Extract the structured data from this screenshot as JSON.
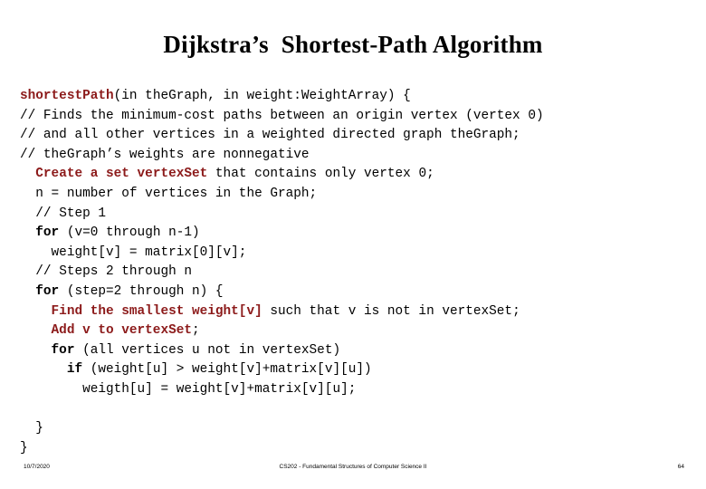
{
  "slide": {
    "title": "Dijkstra’s  Shortest-Path Algorithm",
    "colors": {
      "background": "#ffffff",
      "text": "#000000",
      "highlight_red": "#8C1A1A"
    }
  },
  "code": {
    "lines": [
      {
        "indent": 0,
        "segments": [
          {
            "style": "hl",
            "text": "shortestPath"
          },
          {
            "style": "plain",
            "text": "(in theGraph, in weight:WeightArray) {"
          }
        ]
      },
      {
        "indent": 0,
        "segments": [
          {
            "style": "plain",
            "text": "// Finds the minimum-cost paths between an origin vertex (vertex 0)"
          }
        ]
      },
      {
        "indent": 0,
        "segments": [
          {
            "style": "plain",
            "text": "// and all other vertices in a weighted directed graph theGraph;"
          }
        ]
      },
      {
        "indent": 0,
        "segments": [
          {
            "style": "plain",
            "text": "// theGraph’s weights are nonnegative"
          }
        ]
      },
      {
        "indent": 1,
        "segments": [
          {
            "style": "hl",
            "text": "Create a set vertexSet"
          },
          {
            "style": "plain",
            "text": " that contains only vertex 0;"
          }
        ]
      },
      {
        "indent": 1,
        "segments": [
          {
            "style": "plain",
            "text": "n = number of vertices in the Graph;"
          }
        ]
      },
      {
        "indent": 1,
        "segments": [
          {
            "style": "plain",
            "text": "// Step 1"
          }
        ]
      },
      {
        "indent": 1,
        "segments": [
          {
            "style": "kw",
            "text": "for"
          },
          {
            "style": "plain",
            "text": " (v=0 through n-1)"
          }
        ]
      },
      {
        "indent": 2,
        "segments": [
          {
            "style": "plain",
            "text": "weight[v] = matrix[0][v];"
          }
        ]
      },
      {
        "indent": 1,
        "segments": [
          {
            "style": "plain",
            "text": "// Steps 2 through n"
          }
        ]
      },
      {
        "indent": 1,
        "segments": [
          {
            "style": "kw",
            "text": "for"
          },
          {
            "style": "plain",
            "text": " (step=2 through n) {"
          }
        ]
      },
      {
        "indent": 2,
        "segments": [
          {
            "style": "hl",
            "text": "Find the smallest weight[v]"
          },
          {
            "style": "plain",
            "text": " such that v is not in vertexSet;"
          }
        ]
      },
      {
        "indent": 2,
        "segments": [
          {
            "style": "hl",
            "text": "Add v to vertexSet"
          },
          {
            "style": "plain",
            "text": ";"
          }
        ]
      },
      {
        "indent": 2,
        "segments": [
          {
            "style": "kw",
            "text": "for"
          },
          {
            "style": "plain",
            "text": " (all vertices u not in vertexSet)"
          }
        ]
      },
      {
        "indent": 3,
        "segments": [
          {
            "style": "kw",
            "text": "if"
          },
          {
            "style": "plain",
            "text": " (weight[u] > weight[v]+matrix[v][u])"
          }
        ]
      },
      {
        "indent": 4,
        "segments": [
          {
            "style": "plain",
            "text": "weigth[u] = weight[v]+matrix[v][u];"
          }
        ]
      },
      {
        "indent": 0,
        "segments": [
          {
            "style": "plain",
            "text": ""
          }
        ]
      },
      {
        "indent": 1,
        "segments": [
          {
            "style": "plain",
            "text": "}"
          }
        ]
      },
      {
        "indent": 0,
        "segments": [
          {
            "style": "plain",
            "text": "}"
          }
        ]
      }
    ]
  },
  "footer": {
    "date": "10/7/2020",
    "course": "CS202 - Fundamental Structures of Computer Science II",
    "page_number": "64"
  }
}
